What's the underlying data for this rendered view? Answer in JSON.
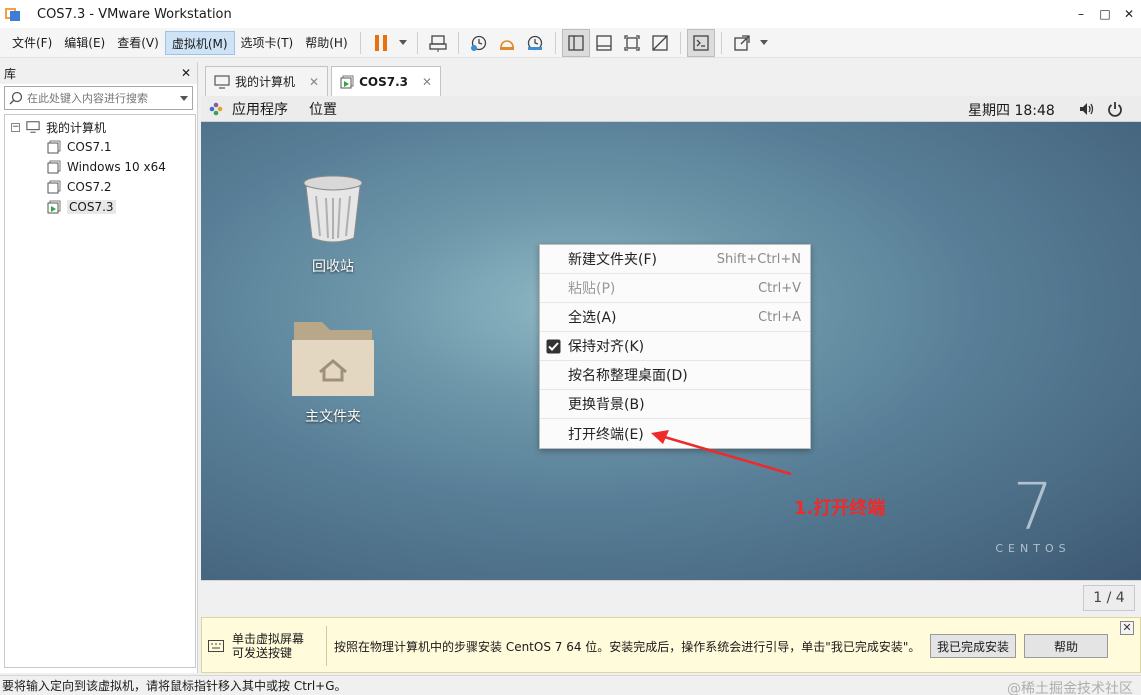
{
  "window": {
    "title": "COS7.3 - VMware Workstation",
    "controls": [
      "–",
      "□",
      "✕"
    ]
  },
  "menu": {
    "items": [
      "文件(F)",
      "编辑(E)",
      "查看(V)",
      "虚拟机(M)",
      "选项卡(T)",
      "帮助(H)"
    ],
    "active_index": 3
  },
  "toolbar": {
    "icons": [
      "pause-icon",
      "send-ctrl-alt-del-icon",
      "snapshot-icon",
      "revert-snapshot-icon",
      "snapshot-manager-icon",
      "library-view-icon",
      "console-view-icon",
      "fit-guest-icon",
      "unity-icon",
      "terminal-icon",
      "fullscreen-icon"
    ]
  },
  "library": {
    "title": "库",
    "close": "✕",
    "search_placeholder": "在此处键入内容进行搜索",
    "root": "我的计算机",
    "items": [
      "COS7.1",
      "Windows 10 x64",
      "COS7.2",
      "COS7.3"
    ],
    "selected_index": 3
  },
  "tabs": [
    {
      "label": "我的计算机",
      "close": "✕"
    },
    {
      "label": "COS7.3",
      "close": "✕"
    }
  ],
  "guest": {
    "topbar": {
      "apps": "应用程序",
      "places": "位置",
      "clock": "星期四 18:48"
    },
    "desktop_icons": [
      {
        "label": "回收站"
      },
      {
        "label": "主文件夹"
      }
    ],
    "context_menu": [
      {
        "label": "新建文件夹(F)",
        "shortcut": "Shift+Ctrl+N",
        "enabled": true,
        "checked": false
      },
      {
        "label": "粘贴(P)",
        "shortcut": "Ctrl+V",
        "enabled": false,
        "checked": false
      },
      {
        "label": "全选(A)",
        "shortcut": "Ctrl+A",
        "enabled": true,
        "checked": false
      },
      {
        "label": "保持对齐(K)",
        "shortcut": "",
        "enabled": true,
        "checked": true
      },
      {
        "label": "按名称整理桌面(D)",
        "shortcut": "",
        "enabled": true,
        "checked": false
      },
      {
        "label": "更换背景(B)",
        "shortcut": "",
        "enabled": true,
        "checked": false
      },
      {
        "label": "打开终端(E)",
        "shortcut": "",
        "enabled": true,
        "checked": false
      }
    ],
    "annotation": "1.打开终端",
    "annotation_color": "#ee2a2a",
    "logo_number": "7",
    "logo_text": "CENTOS"
  },
  "vm_status": {
    "page": "1 / 4"
  },
  "hint": {
    "click_line1": "单击虚拟屏幕",
    "click_line2": "可发送按键",
    "message": "按照在物理计算机中的步骤安装 CentOS 7 64 位。安装完成后，操作系统会进行引导，单击\"我已完成安装\"。",
    "done_button": "我已完成安装",
    "help_button": "帮助",
    "close": "✕"
  },
  "statusbar": {
    "text": "要将输入定向到该虚拟机，请将鼠标指针移入其中或按 Ctrl+G。",
    "watermark": "@稀土掘金技术社区"
  }
}
